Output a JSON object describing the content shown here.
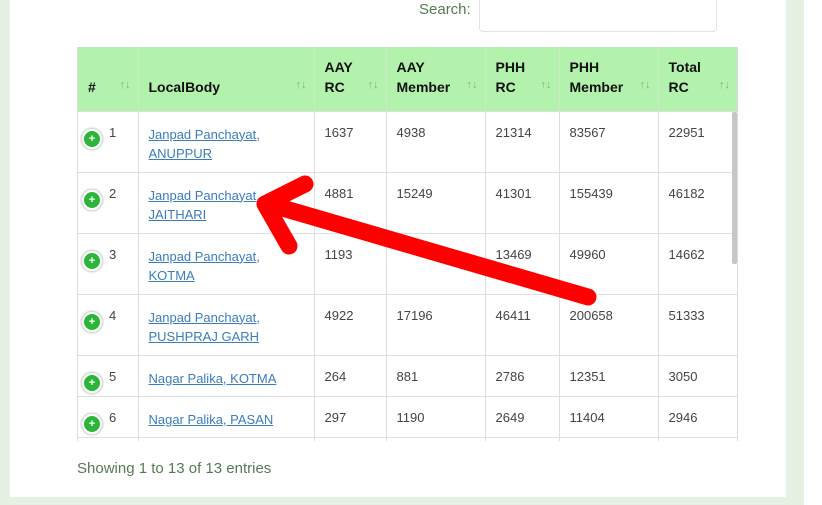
{
  "search": {
    "label": "Search:",
    "value": ""
  },
  "table": {
    "headers": [
      {
        "line1": "#",
        "line2": ""
      },
      {
        "line1": "LocalBody",
        "line2": ""
      },
      {
        "line1": "AAY",
        "line2": "RC"
      },
      {
        "line1": "AAY",
        "line2": "Member"
      },
      {
        "line1": "PHH",
        "line2": "RC"
      },
      {
        "line1": "PHH",
        "line2": "Member"
      },
      {
        "line1": "Total",
        "line2": "RC"
      }
    ],
    "sort_icon": "↑↓",
    "expand_icon": "+",
    "rows": [
      {
        "num": "1",
        "lb1": "Janpad Panchayat,",
        "lb2": "ANUPPUR",
        "aay_rc": "1637",
        "aay_member": "4938",
        "phh_rc": "21314",
        "phh_member": "83567",
        "total_rc": "22951"
      },
      {
        "num": "2",
        "lb1": "Janpad Panchayat,",
        "lb2": "JAITHARI",
        "aay_rc": "4881",
        "aay_member": "15249",
        "phh_rc": "41301",
        "phh_member": "155439",
        "total_rc": "46182"
      },
      {
        "num": "3",
        "lb1": "Janpad Panchayat,",
        "lb2": "KOTMA",
        "aay_rc": "1193",
        "aay_member": "",
        "phh_rc": "13469",
        "phh_member": "49960",
        "total_rc": "14662"
      },
      {
        "num": "4",
        "lb1": "Janpad Panchayat,",
        "lb2": "PUSHPRAJ GARH",
        "aay_rc": "4922",
        "aay_member": "17196",
        "phh_rc": "46411",
        "phh_member": "200658",
        "total_rc": "51333"
      },
      {
        "num": "5",
        "lb1": "Nagar Palika, KOTMA",
        "lb2": "",
        "aay_rc": "264",
        "aay_member": "881",
        "phh_rc": "2786",
        "phh_member": "12351",
        "total_rc": "3050"
      },
      {
        "num": "6",
        "lb1": "Nagar Palika, PASAN",
        "lb2": "",
        "aay_rc": "297",
        "aay_member": "1190",
        "phh_rc": "2649",
        "phh_member": "11404",
        "total_rc": "2946"
      }
    ]
  },
  "info_text": "Showing 1 to 13 of 13 entries",
  "colors": {
    "header_bg": "#b3f2ad",
    "link": "#3a7dbd",
    "expand_button": "#2bb53a",
    "annotation_arrow": "#ff0000",
    "frame": "#e6f0e3"
  },
  "annotation": {
    "icon": "red-arrow-icon"
  }
}
